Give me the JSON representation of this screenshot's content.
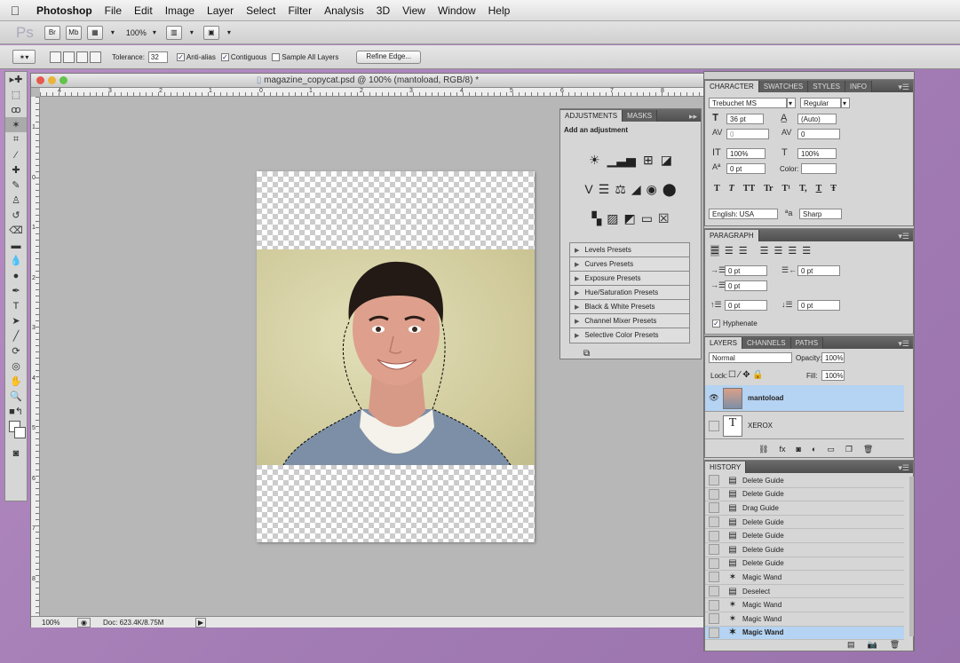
{
  "menubar": {
    "apple": "",
    "app": "Photoshop",
    "items": [
      "File",
      "Edit",
      "Image",
      "Layer",
      "Select",
      "Filter",
      "Analysis",
      "3D",
      "View",
      "Window",
      "Help"
    ]
  },
  "appbar": {
    "logo": "Ps",
    "bridge": "Br",
    "mini": "Mb",
    "zoom": "100%"
  },
  "options": {
    "tolerance_label": "Tolerance:",
    "tolerance_value": "32",
    "antialias": "Anti-alias",
    "contiguous": "Contiguous",
    "sample_all": "Sample All Layers",
    "refine": "Refine Edge..."
  },
  "document": {
    "title": "magazine_copycat.psd @ 100% (mantoload, RGB/8) *",
    "zoom": "100%",
    "doc_size": "Doc: 623.4K/8.75M",
    "ruler_h": [
      "4",
      "3",
      "2",
      "1",
      "0",
      "1",
      "2",
      "3",
      "4",
      "5",
      "6",
      "7",
      "8"
    ],
    "ruler_v": [
      "1",
      "0",
      "1",
      "2",
      "3",
      "4",
      "5",
      "6",
      "7",
      "8"
    ]
  },
  "adjustments": {
    "tabs": [
      "ADJUSTMENTS",
      "MASKS"
    ],
    "heading": "Add an adjustment",
    "presets": [
      "Levels Presets",
      "Curves Presets",
      "Exposure Presets",
      "Hue/Saturation Presets",
      "Black & White Presets",
      "Channel Mixer Presets",
      "Selective Color Presets"
    ]
  },
  "character": {
    "tabs": [
      "CHARACTER",
      "SWATCHES",
      "STYLES",
      "INFO"
    ],
    "font": "Trebuchet MS",
    "style": "Regular",
    "size": "36 pt",
    "leading": "(Auto)",
    "kerning": "0",
    "tracking": "0",
    "vscale": "100%",
    "hscale": "100%",
    "baseline": "0 pt",
    "color_label": "Color:",
    "typo": [
      "T",
      "T",
      "TT",
      "Tr",
      "T¹",
      "T,",
      "T",
      "Ŧ"
    ],
    "language": "English: USA",
    "aa": "Sharp"
  },
  "paragraph": {
    "tab": "PARAGRAPH",
    "indent_left": "0 pt",
    "indent_right": "0 pt",
    "first_line": "0 pt",
    "space_before": "0 pt",
    "space_after": "0 pt",
    "hyphenate": "Hyphenate"
  },
  "layers": {
    "tabs": [
      "LAYERS",
      "CHANNELS",
      "PATHS"
    ],
    "blend": "Normal",
    "opacity_label": "Opacity:",
    "opacity": "100%",
    "lock_label": "Lock:",
    "fill_label": "Fill:",
    "fill": "100%",
    "items": [
      "mantoload",
      "XEROX"
    ]
  },
  "history": {
    "tab": "HISTORY",
    "items": [
      "Delete Guide",
      "Delete Guide",
      "Drag Guide",
      "Delete Guide",
      "Delete Guide",
      "Delete Guide",
      "Delete Guide",
      "Magic Wand",
      "Deselect",
      "Magic Wand",
      "Magic Wand",
      "Magic Wand"
    ]
  }
}
